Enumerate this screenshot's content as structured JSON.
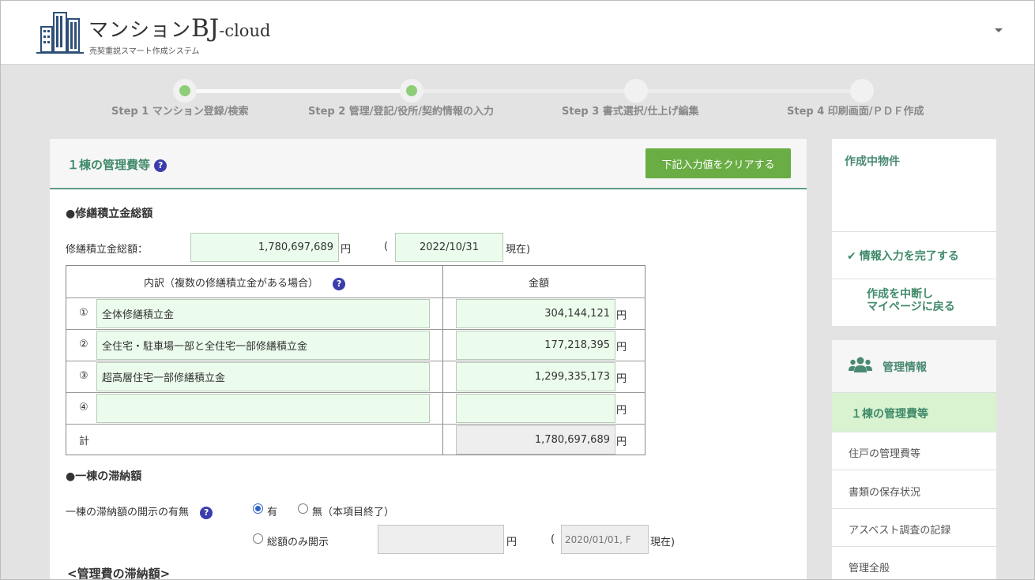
{
  "header": {
    "logo_title_jp": "マンション",
    "logo_title_bj": "BJ",
    "logo_title_cloud": "-cloud",
    "logo_subtitle": "売契重説スマート作成システム",
    "menu_icon": "caret-down-icon"
  },
  "steps": [
    {
      "label": "Step 1 マンション登録/検索",
      "status": "done"
    },
    {
      "label": "Step 2 管理/登記/役所/契約情報の入力",
      "status": "current"
    },
    {
      "label": "Step 3 書式選択/仕上げ編集",
      "status": "pending"
    },
    {
      "label": "Step 4 印刷画面/ＰＤＦ作成",
      "status": "pending"
    }
  ],
  "main": {
    "title": "１棟の管理費等",
    "help_icon": "?",
    "clear_button": "下記入力値をクリアする",
    "repair_section": {
      "title": "●修繕積立金総額",
      "total_label": "修繕積立金総額：",
      "total_value": "1,780,697,689",
      "yen": "円",
      "paren_open": "(",
      "as_of_date": "2022/10/31",
      "as_of_suffix": "現在)",
      "table": {
        "col_breakdown": "内訳（複数の修繕積立金がある場合）",
        "col_amount": "金額",
        "rows": [
          {
            "num": "①",
            "name": "全体修繕積立金",
            "amount": "304,144,121"
          },
          {
            "num": "②",
            "name": "全住宅・駐車場一部と全住宅一部修繕積立金",
            "amount": "177,218,395"
          },
          {
            "num": "③",
            "name": "超高層住宅一部修繕積立金",
            "amount": "1,299,335,173"
          },
          {
            "num": "④",
            "name": "",
            "amount": ""
          }
        ],
        "total_label": "計",
        "total_amount": "1,780,697,689"
      }
    },
    "arrears_section": {
      "title": "●一棟の滞納額",
      "disclosure_label": "一棟の滞納額の開示の有無",
      "option_yes": "有",
      "option_no": "無（本項目終了）",
      "option_total_only": "総額のみ開示",
      "amount_value": "",
      "yen": "円",
      "paren_open": "(",
      "date_placeholder": "2020/01/01, F",
      "as_of_suffix": "現在)"
    },
    "mgmt_arrears_title": "<管理費の滞納額>"
  },
  "sidebar": {
    "project_title": "作成中物件",
    "complete_button": "情報入力を完了する",
    "suspend_line1": "作成を中断し",
    "suspend_line2": "マイページに戻る",
    "mgmt_info_title": "管理情報",
    "items": [
      {
        "label": "１棟の管理費等",
        "active": true
      },
      {
        "label": "住戸の管理費等",
        "active": false
      },
      {
        "label": "書類の保存状況",
        "active": false
      },
      {
        "label": "アスベスト調査の記録",
        "active": false
      },
      {
        "label": "管理全般",
        "active": false
      }
    ]
  },
  "colors": {
    "accent_green": "#6aad45",
    "title_green": "#3f8a6a",
    "input_bg": "#ebfcec",
    "help_blue": "#3a3dac"
  }
}
